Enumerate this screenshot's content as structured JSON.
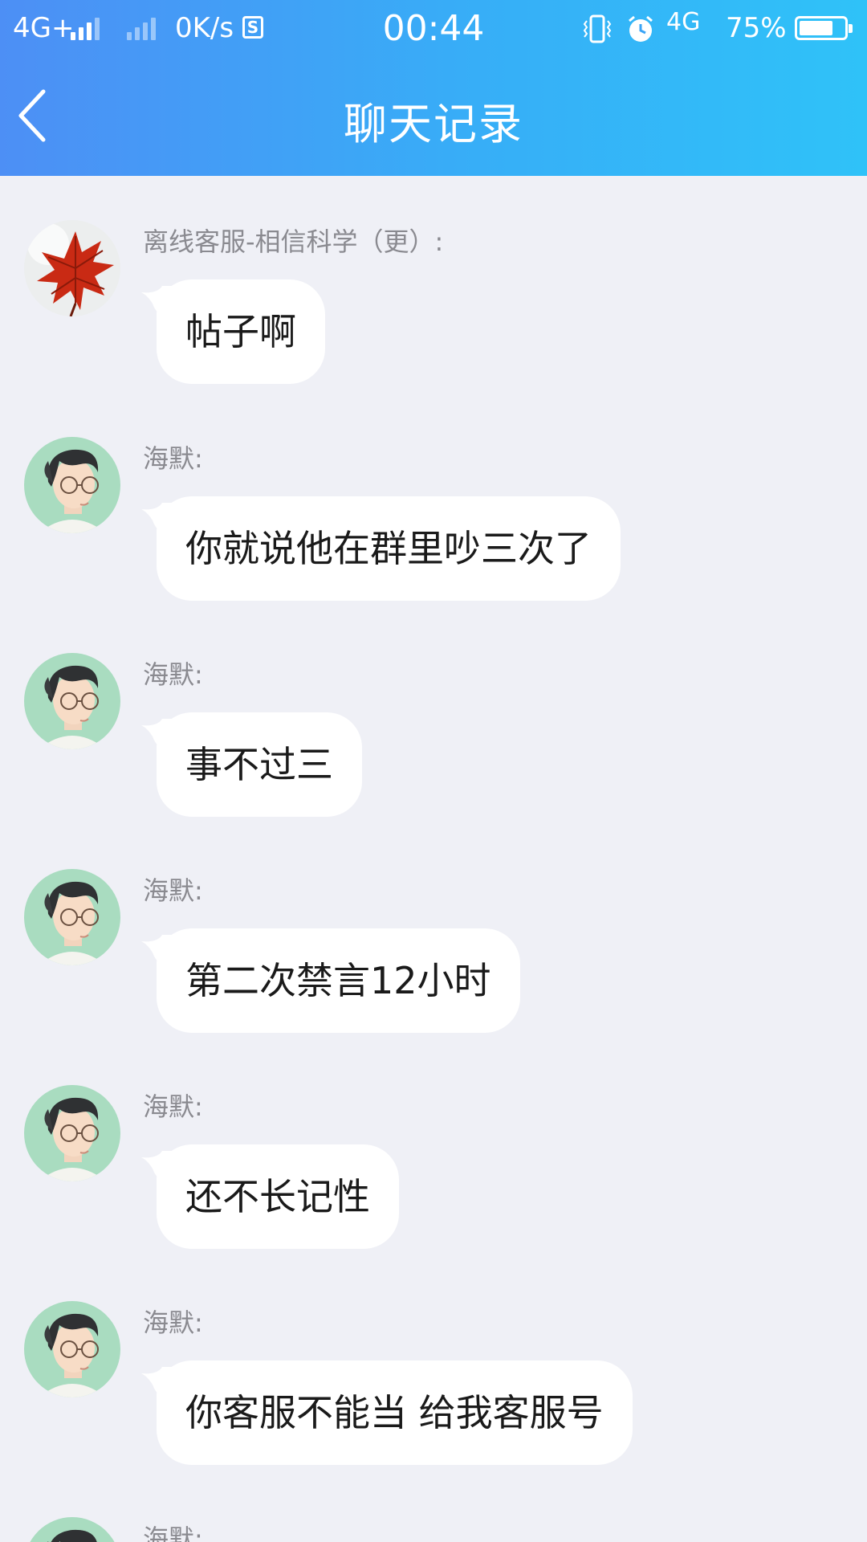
{
  "status_bar": {
    "network_left": "4G+",
    "speed": "0K/s",
    "s_icon": "S",
    "time": "00:44",
    "network_right": "4G",
    "battery": "75%",
    "battery_level": 0.75,
    "icons": [
      "signal-icon",
      "vibrate-icon",
      "alarm-icon",
      "battery-icon"
    ]
  },
  "header": {
    "title": "聊天记录",
    "back_icon": "chevron-left-icon"
  },
  "messages": [
    {
      "sender": "离线客服-相信科学（更）:",
      "text": "帖子啊",
      "avatar": "maple-leaf-avatar"
    },
    {
      "sender": "海默:",
      "text": "你就说他在群里吵三次了",
      "avatar": "glasses-man-avatar"
    },
    {
      "sender": "海默:",
      "text": "事不过三",
      "avatar": "glasses-man-avatar"
    },
    {
      "sender": "海默:",
      "text": "第二次禁言12小时",
      "avatar": "glasses-man-avatar"
    },
    {
      "sender": "海默:",
      "text": "还不长记性",
      "avatar": "glasses-man-avatar"
    },
    {
      "sender": "海默:",
      "text": "你客服不能当 给我客服号",
      "avatar": "glasses-man-avatar"
    },
    {
      "sender": "海默:",
      "text": "",
      "avatar": "glasses-man-avatar"
    }
  ],
  "colors": {
    "header_start": "#4d8ff5",
    "header_end": "#2fc2f8",
    "background": "#eff0f6",
    "bubble": "#ffffff"
  }
}
